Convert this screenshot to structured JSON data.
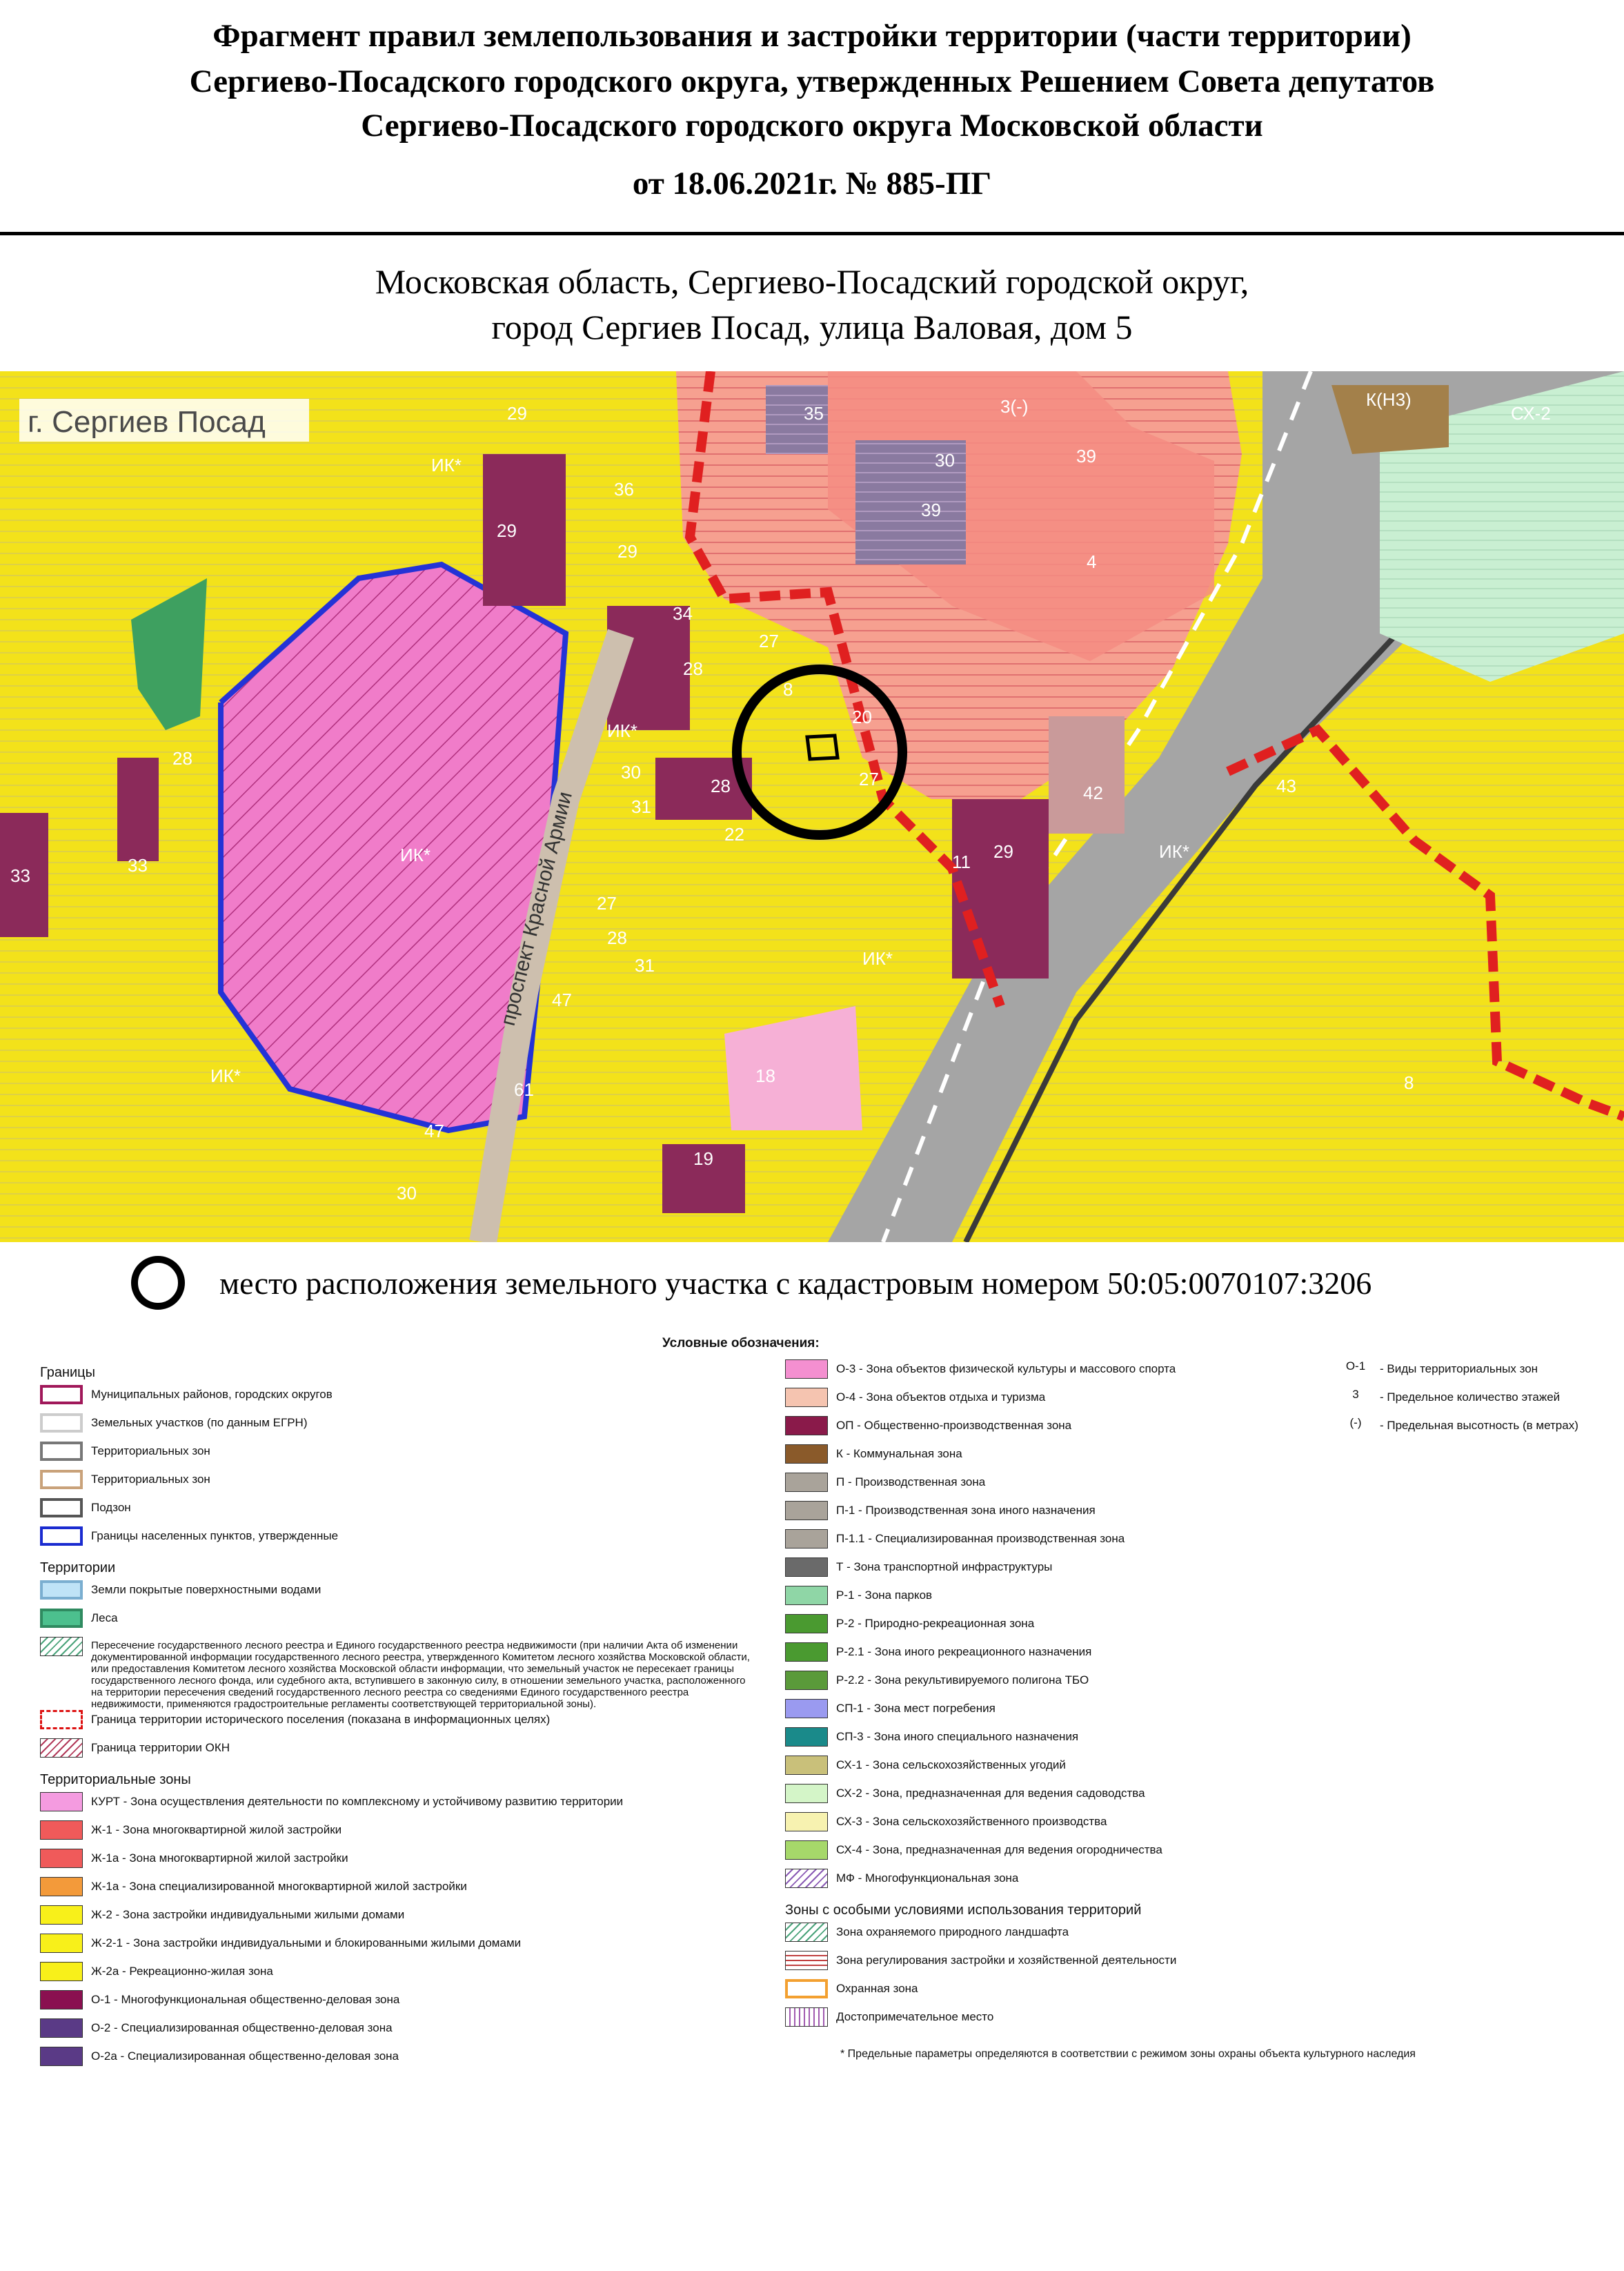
{
  "header": {
    "line1": "Фрагмент правил землепользования и застройки территории (части территории)",
    "line2": "Сергиево-Посадского городского округа, утвержденных Решением Совета депутатов",
    "line3": "Сергиево-Посадского городского округа Московской области",
    "line4": "от 18.06.2021г. № 885-ПГ"
  },
  "address": {
    "line1": "Московская область, Сергиево-Посадский городской округ,",
    "line2": "город Сергиев Посад, улица Валовая, дом 5"
  },
  "map": {
    "place_label": "г. Сергиев Посад",
    "street_label": "проспект Красной Армии",
    "zone_labels": [
      "29",
      "ИК*",
      "35",
      "30",
      "39",
      "39",
      "36",
      "29",
      "29",
      "34",
      "28",
      "4",
      "27",
      "8",
      "20",
      "27",
      "ИК*",
      "30",
      "28",
      "42",
      "43",
      "28",
      "33",
      "ИК*",
      "31",
      "22",
      "33",
      "11",
      "ИК*",
      "29",
      "ИК*",
      "27",
      "28",
      "8",
      "47",
      "31",
      "18",
      "61",
      "47",
      "19",
      "30",
      "ИК*",
      "3(-)",
      "СХ-2",
      "К(Н3)"
    ],
    "colors": {
      "yellow": "#f3e21a",
      "pink": "#f07cc9",
      "red": "#f48c82",
      "purple": "#8b2a5a",
      "violet": "#6b4b8c",
      "gray": "#9a9a9a",
      "green": "#3ea060",
      "boundary_blue": "#2433d6",
      "boundary_red": "#e02020"
    }
  },
  "marker": {
    "text": "место расположения земельного участка с кадастровым номером 50:05:0070107:3206"
  },
  "legend": {
    "title": "Условные обозначения:",
    "col1_sections": [
      {
        "heading": "Границы",
        "items": [
          {
            "label": "Муниципальных районов, городских округов",
            "color": "#ffffff",
            "border": "#a0185a"
          },
          {
            "label": "Земельных участков (по данным ЕГРН)",
            "color": "#ffffff",
            "border": "#cccccc"
          },
          {
            "label": "Территориальных зон",
            "color": "#ffffff",
            "border": "#777777"
          },
          {
            "label": "Территориальных зон",
            "color": "#ffffff",
            "border": "#c9a27a"
          },
          {
            "label": "Подзон",
            "color": "#ffffff",
            "border": "#555555"
          },
          {
            "label": "Границы населенных пунктов, утвержденные",
            "color": "#ffffff",
            "border": "#1a2bd0"
          }
        ]
      },
      {
        "heading": "Территории",
        "items": [
          {
            "label": "Земли покрытые поверхностными водами",
            "color": "#bfe3f7",
            "border": "#7aaed0"
          },
          {
            "label": "Леса",
            "color": "#4cc08e",
            "border": "#2f8a60"
          }
        ]
      }
    ],
    "forest_note": "Пересечение государственного лесного реестра и Единого государственного реестра недвижимости (при наличии Акта об изменении документированной информации государственного лесного реестра, утвержденного Комитетом лесного хозяйства Московской области, или предоставления Комитетом лесного хозяйства Московской области информации, что земельный участок не пересекает границы государственного лесного фонда, или судебного акта, вступившего в законную силу, в отношении земельного участка, расположенного на территории пересечения сведений государственного лесного реестра со сведениями Единого государственного реестра недвижимости, применяются градостроительные регламенты соответствующей территориальной зоны).",
    "historic_label": "Граница территории исторического поселения (показана в информационных целях)",
    "okn_label": "Граница территории ОКН",
    "zones_heading": "Территориальные зоны",
    "zones_col1": [
      {
        "label": "КУРТ - Зона осуществления деятельности по комплексному и устойчивому развитию территории",
        "color": "#f49be0"
      },
      {
        "label": "Ж-1 - Зона многоквартирной жилой застройки",
        "color": "#f05a5a"
      },
      {
        "label": "Ж-1а - Зона многоквартирной жилой застройки",
        "color": "#f05a5a"
      },
      {
        "label": "Ж-1а - Зона специализированной многоквартирной жилой застройки",
        "color": "#f39a3a"
      },
      {
        "label": "Ж-2 - Зона застройки индивидуальными жилыми домами",
        "color": "#f8f01a"
      },
      {
        "label": "Ж-2-1 - Зона застройки индивидуальными и блокированными жилыми домами",
        "color": "#f8f01a"
      },
      {
        "label": "Ж-2а - Рекреационно-жилая зона",
        "color": "#f8f01a"
      },
      {
        "label": "О-1 - Многофункциональная общественно-деловая зона",
        "color": "#8a1050"
      },
      {
        "label": "О-2 - Специализированная общественно-деловая зона",
        "color": "#5a3a86"
      },
      {
        "label": "О-2а - Специализированная общественно-деловая зона",
        "color": "#5a3a86"
      }
    ],
    "zones_col2": [
      {
        "label": "О-3 - Зона объектов физической культуры и массового спорта",
        "color": "#f48fd0"
      },
      {
        "label": "О-4 - Зона объектов отдыха и туризма",
        "color": "#f5c4b0"
      },
      {
        "label": "ОП - Общественно-производственная зона",
        "color": "#8a1a4a"
      },
      {
        "label": "К - Коммунальная зона",
        "color": "#8a5a2a"
      },
      {
        "label": "П - Производственная зона",
        "color": "#a9a39a"
      },
      {
        "label": "П-1 - Производственная зона иного назначения",
        "color": "#a9a39a"
      },
      {
        "label": "П-1.1 - Специализированная производственная зона",
        "color": "#a9a39a"
      },
      {
        "label": "Т - Зона транспортной инфраструктуры",
        "color": "#6a6a6a"
      },
      {
        "label": "Р-1 - Зона парков",
        "color": "#8fd6a6"
      },
      {
        "label": "Р-2 - Природно-рекреационная зона",
        "color": "#4a9a30"
      },
      {
        "label": "Р-2.1 - Зона иного рекреационного назначения",
        "color": "#4a9a30"
      },
      {
        "label": "Р-2.2 - Зона рекультивируемого полигона ТБО",
        "color": "#5a9a3a"
      },
      {
        "label": "СП-1 - Зона мест погребения",
        "color": "#9a9af0"
      },
      {
        "label": "СП-3 - Зона иного специального назначения",
        "color": "#1a8a8a"
      },
      {
        "label": "СХ-1 - Зона сельскохозяйственных угодий",
        "color": "#c9c07a"
      },
      {
        "label": "СХ-2 - Зона, предназначенная для ведения садоводства",
        "color": "#d4f5c8"
      },
      {
        "label": "СХ-3 - Зона сельскохозяйственного производства",
        "color": "#f7f2b0"
      },
      {
        "label": "СХ-4 - Зона, предназначенная для ведения огородничества",
        "color": "#a6d86a"
      },
      {
        "label": "МФ - Многофункциональная зона",
        "color": "#ffffff"
      }
    ],
    "special_heading": "Зоны с особыми условиями использования территорий",
    "special_items": [
      {
        "label": "Зона охраняемого природного ландшафта",
        "color": "#ffffff"
      },
      {
        "label": "Зона регулирования застройки и хозяйственной деятельности",
        "color": "#ffffff"
      },
      {
        "label": "Охранная зона",
        "color": "#ffffff"
      },
      {
        "label": "Достопримечательное место",
        "color": "#ffffff"
      }
    ],
    "footnote": "* Предельные параметры определяются в соответствии с режимом зоны охраны объекта культурного наследия",
    "col3": [
      {
        "key": "О-1",
        "label": "- Виды территориальных зон"
      },
      {
        "key": "3",
        "label": "- Предельное количество этажей"
      },
      {
        "key": "(-)",
        "label": "- Предельная высотность (в метрах)"
      }
    ]
  }
}
